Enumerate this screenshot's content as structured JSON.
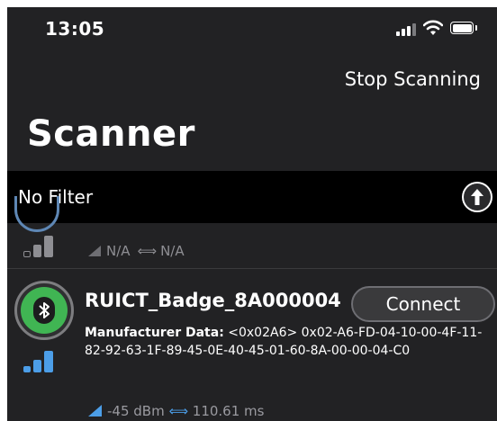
{
  "status_bar": {
    "time": "13:05"
  },
  "header": {
    "stop_label": "Stop Scanning",
    "title": "Scanner"
  },
  "filter": {
    "label": "No Filter"
  },
  "partial_row": {
    "rssi": "N/A",
    "interval": "N/A"
  },
  "device": {
    "name": "RUICT_Badge_8A000004",
    "connect_label": "Connect",
    "manufacturer_label": "Manufacturer Data:",
    "manufacturer_value": "<0x02A6> 0x02-A6-FD-04-10-00-4F-11-82-92-63-1F-89-45-0E-40-45-01-60-8A-00-00-04-C0",
    "rssi": "-45 dBm",
    "interval": "110.61 ms"
  },
  "colors": {
    "background": "#222224",
    "filter_bar": "#000000",
    "bluetooth_green": "#40b553",
    "accent_blue": "#4c9ee8"
  },
  "icons": [
    "signal-icon",
    "wifi-icon",
    "battery-icon",
    "sort-arrow-icon",
    "bluetooth-icon",
    "rssi-bars-icon",
    "interval-arrows-icon"
  ]
}
